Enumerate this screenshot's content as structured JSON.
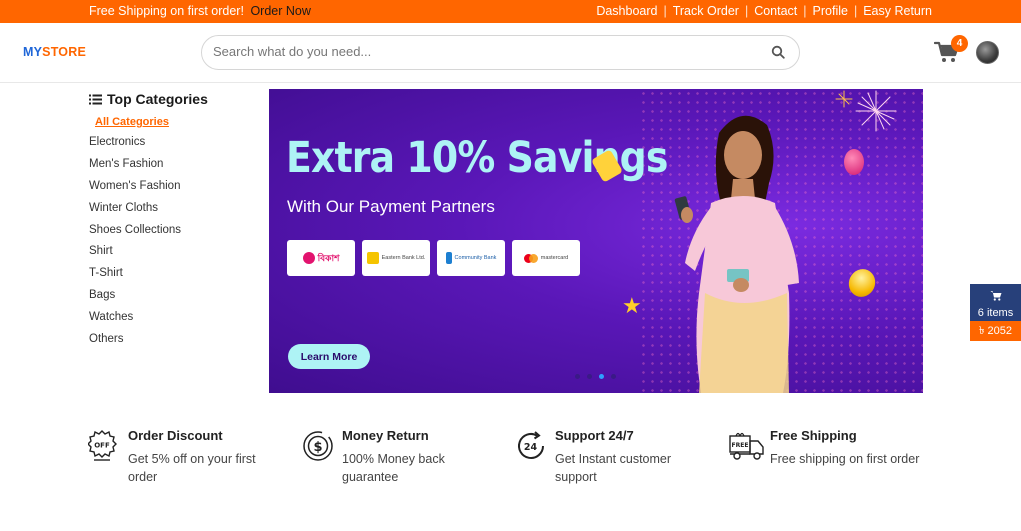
{
  "topbar": {
    "promo_text": "Free Shipping on first order!",
    "promo_link": "Order Now",
    "nav": [
      "Dashboard",
      "Track Order",
      "Contact",
      "Profile",
      "Easy Return"
    ],
    "separator": "|"
  },
  "header": {
    "logo_my": "MY",
    "logo_store": "STORE",
    "search_placeholder": "Search what do you need...",
    "cart_count": "4"
  },
  "categories": {
    "title": "Top Categories",
    "all_label": "All Categories",
    "items": [
      "Electronics",
      "Men's Fashion",
      "Women's Fashion",
      "Winter Cloths",
      "Shoes Collections",
      "Shirt",
      "T-Shirt",
      "Bags",
      "Watches",
      "Others"
    ]
  },
  "banner": {
    "headline": "Extra 10% Savings",
    "subheadline": "With Our Payment Partners",
    "partners": [
      "বিকাশ",
      "Eastern Bank Ltd.",
      "Community Bank",
      "mastercard"
    ],
    "cta": "Learn More",
    "active_slide": 3
  },
  "floating_cart": {
    "items_label": "6 items",
    "total": "৳ 2052"
  },
  "features": [
    {
      "title": "Order Discount",
      "desc": "Get 5% off on your first order",
      "icon": "discount-badge-icon"
    },
    {
      "title": "Money Return",
      "desc": "100% Money back guarantee",
      "icon": "money-return-icon"
    },
    {
      "title": "Support 24/7",
      "desc": "Get Instant customer support",
      "icon": "support-24-icon"
    },
    {
      "title": "Free Shipping",
      "desc": "Free shipping on first order",
      "icon": "delivery-truck-icon"
    }
  ],
  "colors": {
    "accent": "#ff6600",
    "brand_blue": "#1f66d8",
    "banner_purple": "#5a17b8",
    "float_cart_blue": "#27407a"
  }
}
